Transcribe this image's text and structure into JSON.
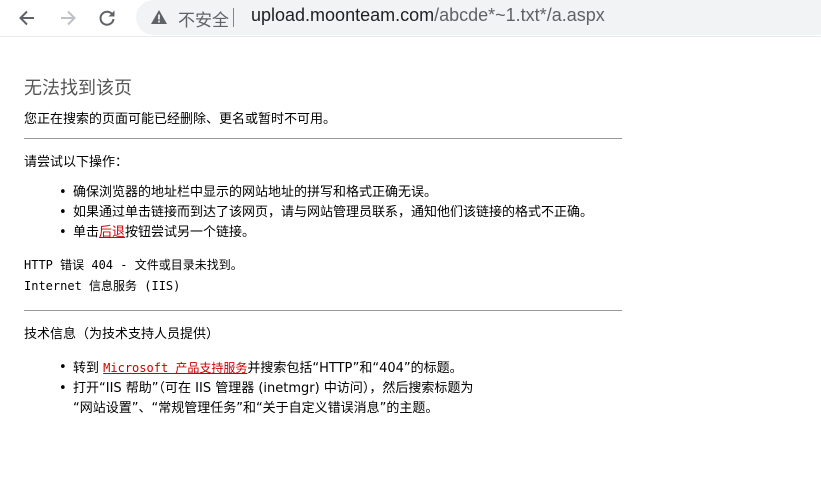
{
  "browser": {
    "security_label": "不安全",
    "url_host": "upload.moonteam.com",
    "url_path": "/abcde*~1.txt*/a.aspx"
  },
  "page": {
    "title": "无法找到该页",
    "lead": "您正在搜索的页面可能已经删除、更名或暂时不可用。",
    "try_heading": "请尝试以下操作：",
    "try_items": [
      "确保浏览器的地址栏中显示的网站地址的拼写和格式正确无误。",
      "如果通过单击链接而到达了该网页，请与网站管理员联系，通知他们该链接的格式不正确。"
    ],
    "back_prefix": "单击",
    "back_link": "后退",
    "back_suffix": "按钮尝试另一个链接。",
    "error_line": "HTTP 错误 404 - 文件或目录未找到。",
    "iis_line": "Internet 信息服务 (IIS)",
    "tech_heading": "技术信息（为技术支持人员提供）",
    "goto_prefix": "转到 ",
    "goto_link": "Microsoft 产品支持服务",
    "goto_suffix": "并搜索包括“HTTP”和“404”的标题。",
    "iis_help_line1": "打开“IIS 帮助”（可在 IIS 管理器 (inetmgr) 中访问），然后搜索标题为",
    "iis_help_line2": "“网站设置”、“常规管理任务”和“关于自定义错误消息”的主题。"
  }
}
